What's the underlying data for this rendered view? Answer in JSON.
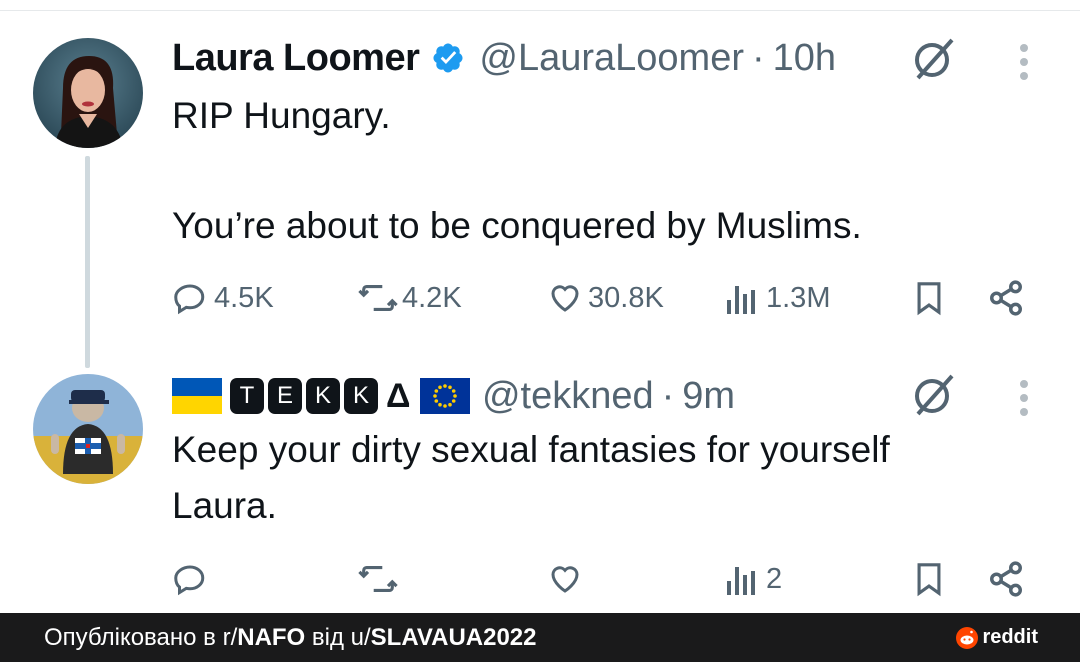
{
  "tweet1": {
    "name": "Laura Loomer",
    "handle": "@LauraLoomer",
    "separator": "·",
    "time": "10h",
    "line1": "RIP Hungary.",
    "line2": "You’re about to be conquered by Muslims.",
    "replies": "4.5K",
    "reposts": "4.2K",
    "likes": "30.8K",
    "views": "1.3M"
  },
  "tweet2": {
    "name_letters": [
      "T",
      "E",
      "K",
      "K"
    ],
    "name_delta": "Δ",
    "handle": "@tekkned",
    "separator": "·",
    "time": "9m",
    "line1": "Keep your dirty sexual fantasies for yourself",
    "line2": "Laura.",
    "views": "2"
  },
  "footer": {
    "prefix": "Опубліковано в r/",
    "subreddit": "NAFO",
    "middle": " від u/",
    "user": "SLAVAUA2022",
    "brand": "reddit"
  },
  "colors": {
    "verified": "#1d9bf0",
    "muted": "#536471",
    "text": "#0f1419",
    "footer_bg": "#1a1a1b",
    "reddit_orange": "#ff4500"
  }
}
